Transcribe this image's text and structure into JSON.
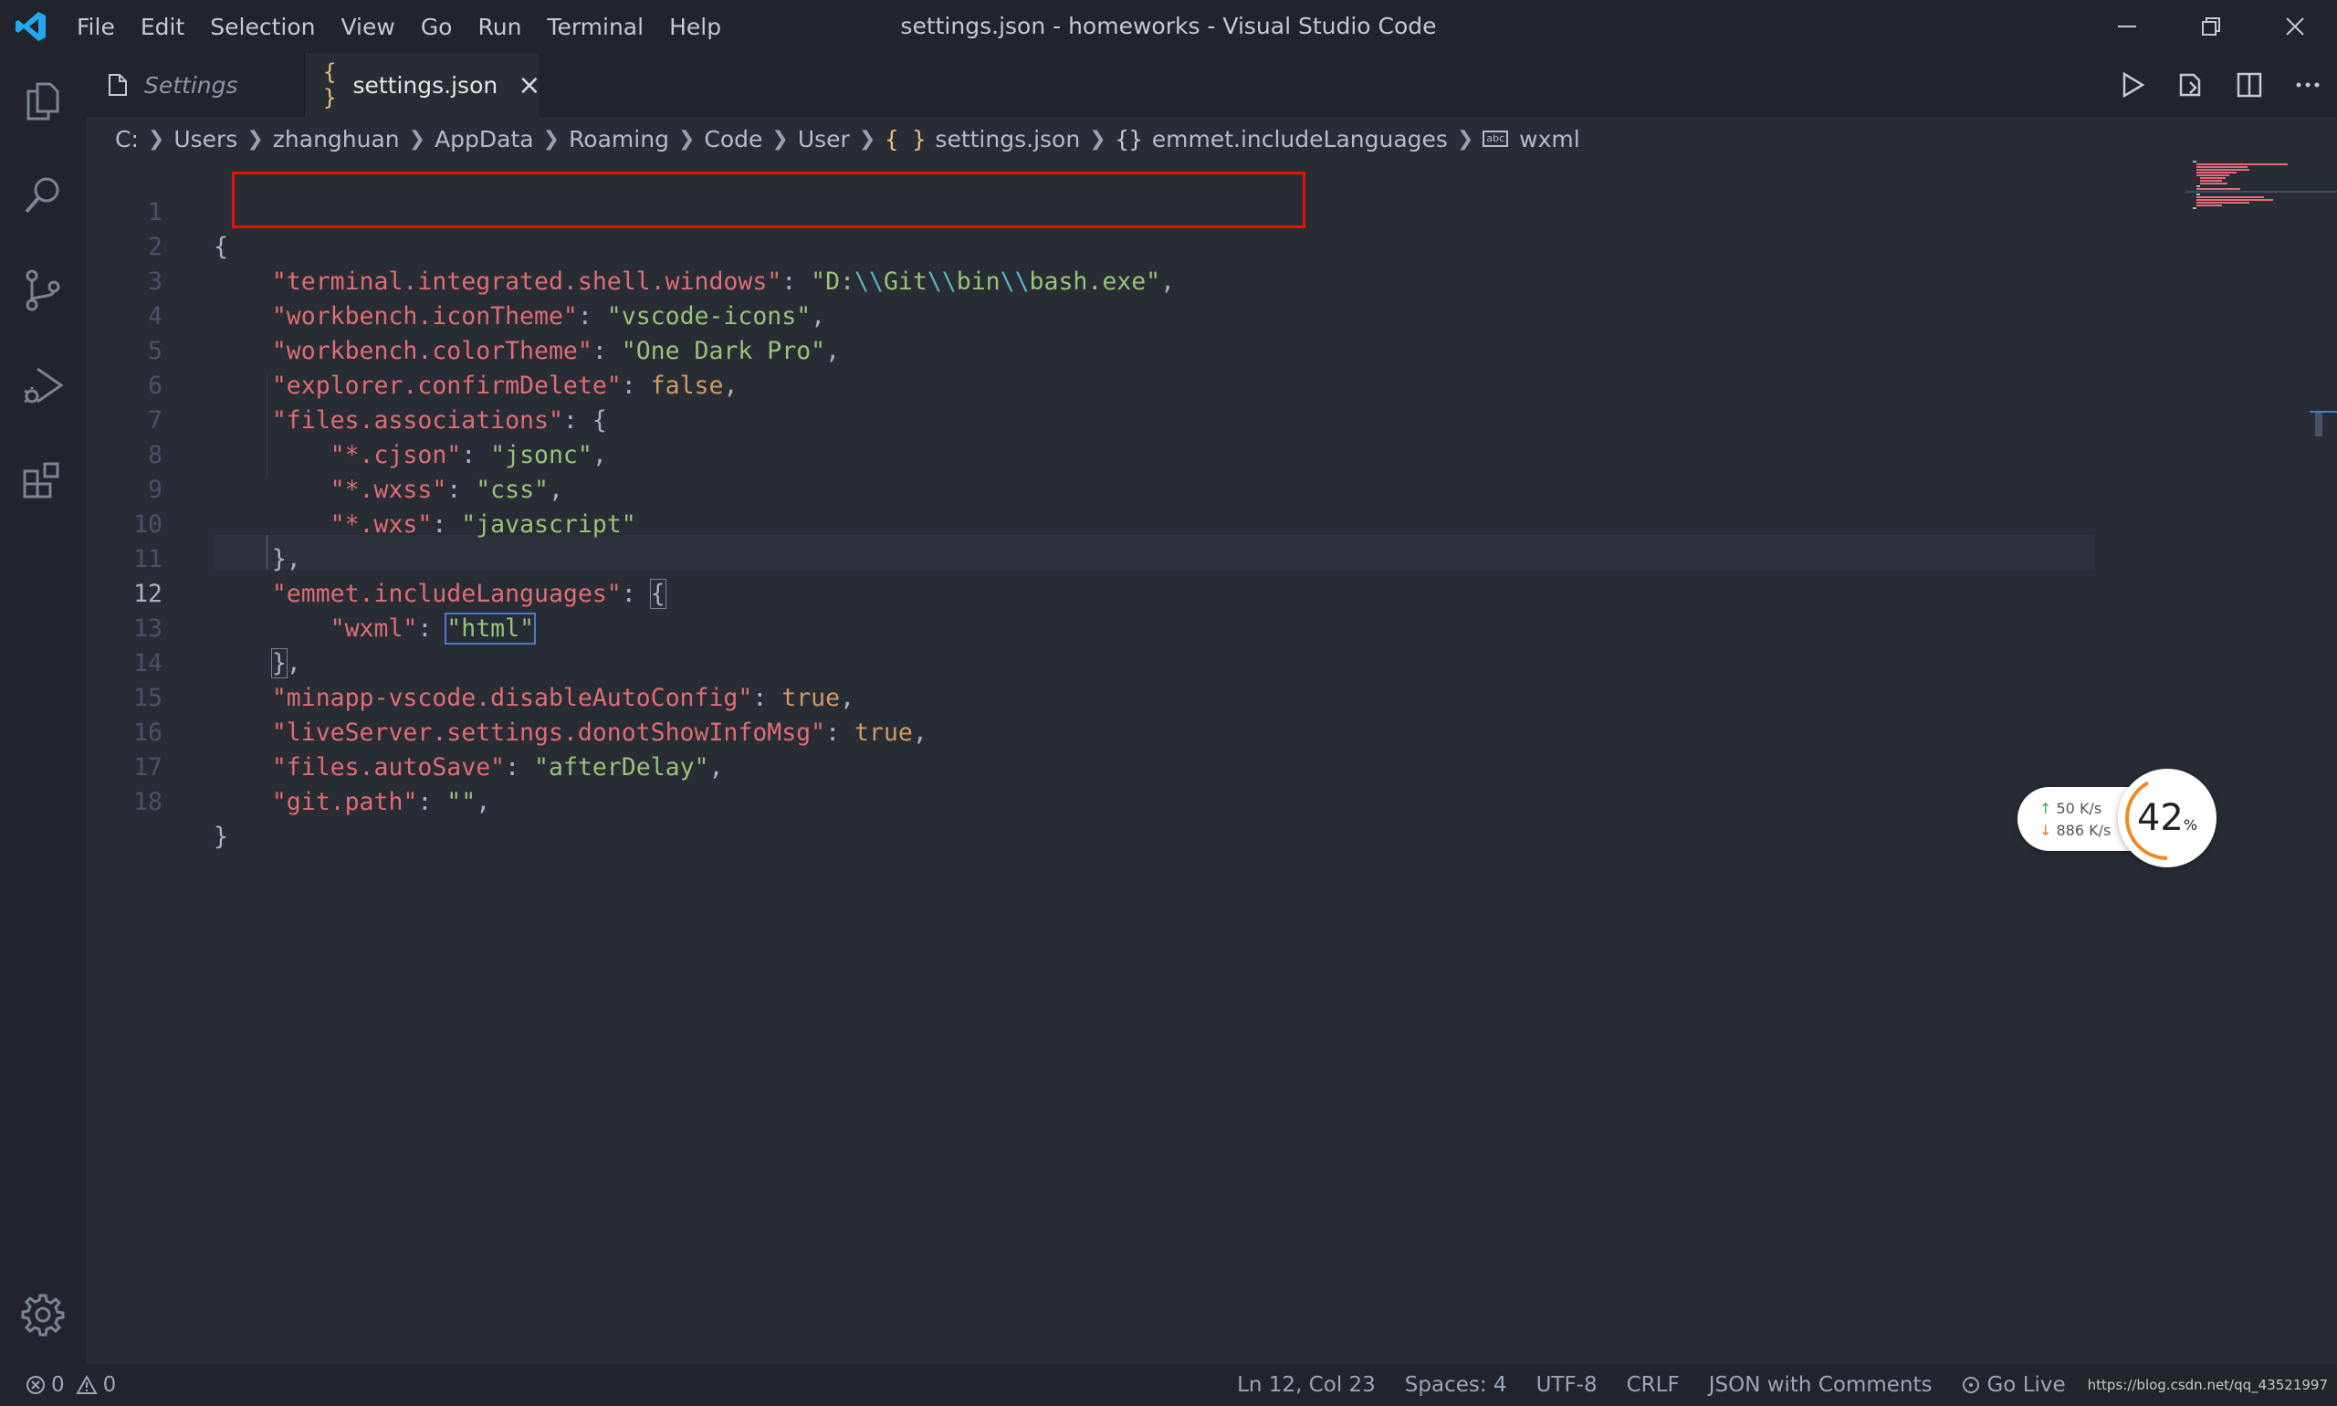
{
  "window": {
    "title": "settings.json - homeworks - Visual Studio Code",
    "menu": [
      "File",
      "Edit",
      "Selection",
      "View",
      "Go",
      "Run",
      "Terminal",
      "Help"
    ],
    "controls": [
      "minimize-icon",
      "restore-icon",
      "close-icon"
    ]
  },
  "activity_bar": {
    "items": [
      "explorer-icon",
      "search-icon",
      "source-control-icon",
      "run-debug-icon",
      "extensions-icon"
    ],
    "bottom": "gear-icon"
  },
  "tabs": [
    {
      "label": "Settings",
      "icon": "file-icon",
      "active": false
    },
    {
      "label": "settings.json",
      "icon": "json-braces-icon",
      "active": true,
      "close": "×"
    }
  ],
  "editor_actions": [
    "run-icon",
    "open-settings-icon",
    "split-editor-icon",
    "more-actions-icon"
  ],
  "breadcrumb": {
    "segments": [
      "C:",
      "Users",
      "zhanghuan",
      "AppData",
      "Roaming",
      "Code",
      "User",
      "settings.json",
      "emmet.includeLanguages",
      "wxml"
    ],
    "json_icon": "{ }",
    "object_icon": "{}",
    "string_icon": "abc"
  },
  "editor": {
    "current_line": 12,
    "line_numbers": [
      "1",
      "2",
      "3",
      "4",
      "5",
      "6",
      "7",
      "8",
      "9",
      "10",
      "11",
      "12",
      "13",
      "14",
      "15",
      "16",
      "17",
      "18"
    ],
    "lines": {
      "l1": {
        "p1": "{"
      },
      "l2": {
        "key": "\"terminal.integrated.shell.windows\"",
        "colon": ": ",
        "s1": "\"D:",
        "e1": "\\\\",
        "s2": "Git",
        "e2": "\\\\",
        "s3": "bin",
        "e3": "\\\\",
        "s4": "bash.exe\"",
        "comma": ","
      },
      "l3": {
        "key": "\"workbench.iconTheme\"",
        "colon": ": ",
        "val": "\"vscode-icons\"",
        "comma": ","
      },
      "l4": {
        "key": "\"workbench.colorTheme\"",
        "colon": ": ",
        "val": "\"One Dark Pro\"",
        "comma": ","
      },
      "l5": {
        "key": "\"explorer.confirmDelete\"",
        "colon": ": ",
        "val": "false",
        "comma": ","
      },
      "l6": {
        "key": "\"files.associations\"",
        "colon": ": ",
        "brace": "{"
      },
      "l7": {
        "key": "\"*.cjson\"",
        "colon": ": ",
        "val": "\"jsonc\"",
        "comma": ","
      },
      "l8": {
        "key": "\"*.wxss\"",
        "colon": ": ",
        "val": "\"css\"",
        "comma": ","
      },
      "l9": {
        "key": "\"*.wxs\"",
        "colon": ": ",
        "val": "\"javascript\""
      },
      "l10": {
        "p1": "},"
      },
      "l11": {
        "key": "\"emmet.includeLanguages\"",
        "colon": ": ",
        "brace": "{"
      },
      "l12": {
        "key": "\"wxml\"",
        "colon": ": ",
        "val": "\"html\""
      },
      "l13": {
        "brace": "}",
        "comma": ","
      },
      "l14": {
        "key": "\"minapp-vscode.disableAutoConfig\"",
        "colon": ": ",
        "val": "true",
        "comma": ","
      },
      "l15": {
        "key": "\"liveServer.settings.donotShowInfoMsg\"",
        "colon": ": ",
        "val": "true",
        "comma": ","
      },
      "l16": {
        "key": "\"files.autoSave\"",
        "colon": ": ",
        "val": "\"afterDelay\"",
        "comma": ","
      },
      "l17": {
        "key": "\"git.path\"",
        "colon": ": ",
        "val": "\"\"",
        "comma": ","
      },
      "l18": {
        "p1": "}"
      }
    }
  },
  "net_widget": {
    "up": "50  K/s",
    "down": "886 K/s",
    "percent": "42",
    "percent_unit": "%",
    "percent_value": 42
  },
  "status_bar": {
    "errors": "0",
    "warnings": "0",
    "position": "Ln 12, Col 23",
    "spaces": "Spaces: 4",
    "encoding": "UTF-8",
    "eol": "CRLF",
    "language": "JSON with Comments",
    "golive": "Go Live",
    "watermark": "https://blog.csdn.net/qq_43521997"
  },
  "colors": {
    "editor_bg": "#282c34",
    "chrome_bg": "#21252b",
    "key": "#e06c75",
    "string": "#98c379",
    "literal": "#d19a66",
    "escape": "#56b6c2",
    "highlight_box": "#e51400",
    "vscode_blue": "#23a9f2"
  }
}
